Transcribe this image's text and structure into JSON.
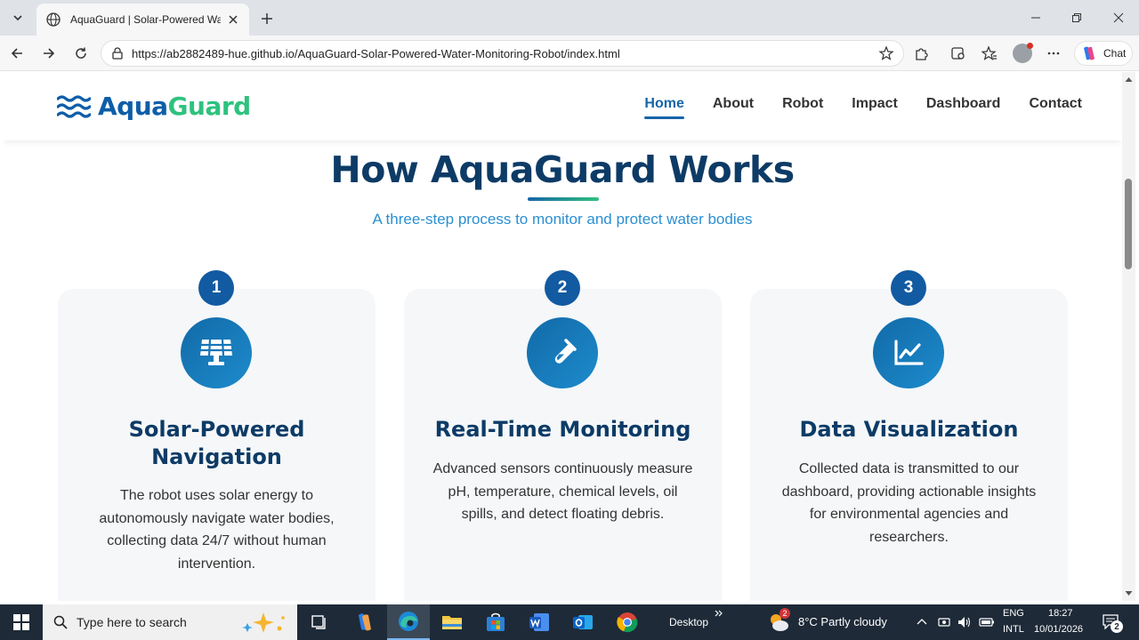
{
  "browser": {
    "tab_title": "AquaGuard | Solar-Powered Water Monitoring Robot",
    "url": "https://ab2882489-hue.github.io/AquaGuard-Solar-Powered-Water-Monitoring-Robot/index.html",
    "chat_label": "Chat"
  },
  "site": {
    "brand_part1": "Aqua",
    "brand_part2": "Guard",
    "nav": [
      {
        "label": "Home",
        "active": true
      },
      {
        "label": "About"
      },
      {
        "label": "Robot"
      },
      {
        "label": "Impact"
      },
      {
        "label": "Dashboard"
      },
      {
        "label": "Contact"
      }
    ]
  },
  "section": {
    "title": "How AquaGuard Works",
    "subtitle": "A three-step process to monitor and protect water bodies",
    "steps": [
      {
        "number": "1",
        "icon": "solar-panel-icon",
        "title": "Solar-Powered Navigation",
        "text": "The robot uses solar energy to autonomously navigate water bodies, collecting data 24/7 without human intervention."
      },
      {
        "number": "2",
        "icon": "test-tube-icon",
        "title": "Real-Time Monitoring",
        "text": "Advanced sensors continuously measure pH, temperature, chemical levels, oil spills, and detect floating debris."
      },
      {
        "number": "3",
        "icon": "line-chart-icon",
        "title": "Data Visualization",
        "text": "Collected data is transmitted to our dashboard, providing actionable insights for environmental agencies and researchers."
      }
    ]
  },
  "taskbar": {
    "search_placeholder": "Type here to search",
    "desktop_label": "Desktop",
    "weather_badge": "2",
    "weather": "8°C  Partly cloudy",
    "lang1": "ENG",
    "lang2": "INTL",
    "time": "18:27",
    "date": "10/01/2026",
    "notif_count": "2"
  },
  "colors": {
    "brand_blue": "#0e5ea8",
    "brand_green": "#2ec27e",
    "heading": "#0d3b66",
    "subtitle": "#2b8fd1"
  }
}
